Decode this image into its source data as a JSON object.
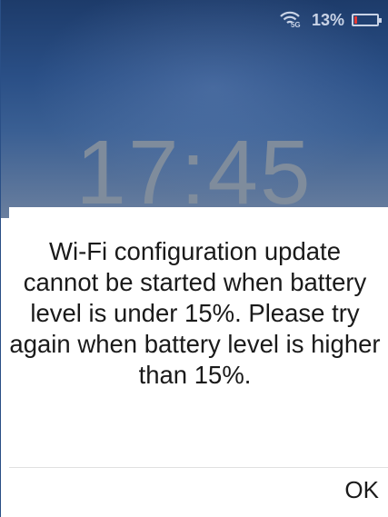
{
  "status_bar": {
    "network_label": "5G",
    "battery_percent_label": "13%",
    "battery_level": 0.13,
    "battery_color": "#e53935",
    "icons": [
      "wifi-icon",
      "battery-icon"
    ]
  },
  "lockscreen": {
    "clock": "17:45"
  },
  "dialog": {
    "message": "Wi-Fi configuration update cannot be started when battery level is under 15%. Please try again when battery level is higher than 15%.",
    "ok_label": "OK"
  }
}
